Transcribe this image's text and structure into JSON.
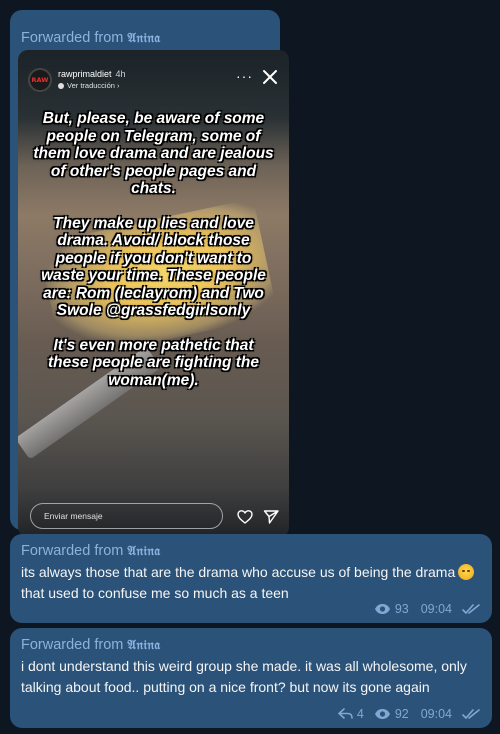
{
  "messages": [
    {
      "forwarded_label": "Forwarded from",
      "author": "𝔄𝔫𝔦𝔫𝔞",
      "story": {
        "avatar_text": "RAW",
        "username": "rawprimaldiet",
        "time_ago": "4h",
        "translate_label": "Ver traducción ›",
        "overlay_paragraphs": [
          "But, please, be aware of some people on Telegram, some of them love drama and are jealous of other's people pages and chats.",
          "They make up lies and love drama. Avoid/ block those people if you don't want to waste your time. These people are: Rom (leclayrom) and Two Swole @grassfedgirlsonly",
          "It's even more pathetic that these people are fighting the woman(me)."
        ],
        "reply_placeholder": "Enviar mensaje",
        "icons": [
          "more-icon",
          "close-icon",
          "heart-icon",
          "send-icon"
        ]
      }
    },
    {
      "forwarded_label": "Forwarded from",
      "author": "𝔄𝔫𝔦𝔫𝔞",
      "text_before_emoji": "its always those that are the drama who accuse us of being the drama",
      "emoji": "rolling-eyes-emoji",
      "text_after_emoji": "that used to confuse me so much as a teen",
      "views": "93",
      "time": "09:04",
      "status": "read"
    },
    {
      "forwarded_label": "Forwarded from",
      "author": "𝔄𝔫𝔦𝔫𝔞",
      "text": "i dont understand this weird group she made. it was all wholesome, only talking about food.. putting on a nice front? but now its gone again",
      "replies": "4",
      "views": "92",
      "time": "09:04",
      "status": "read"
    }
  ],
  "colors": {
    "background": "#0e1621",
    "bubble": "#2b5278",
    "forward_title": "#8ab4df",
    "meta": "#7fa9d4"
  }
}
